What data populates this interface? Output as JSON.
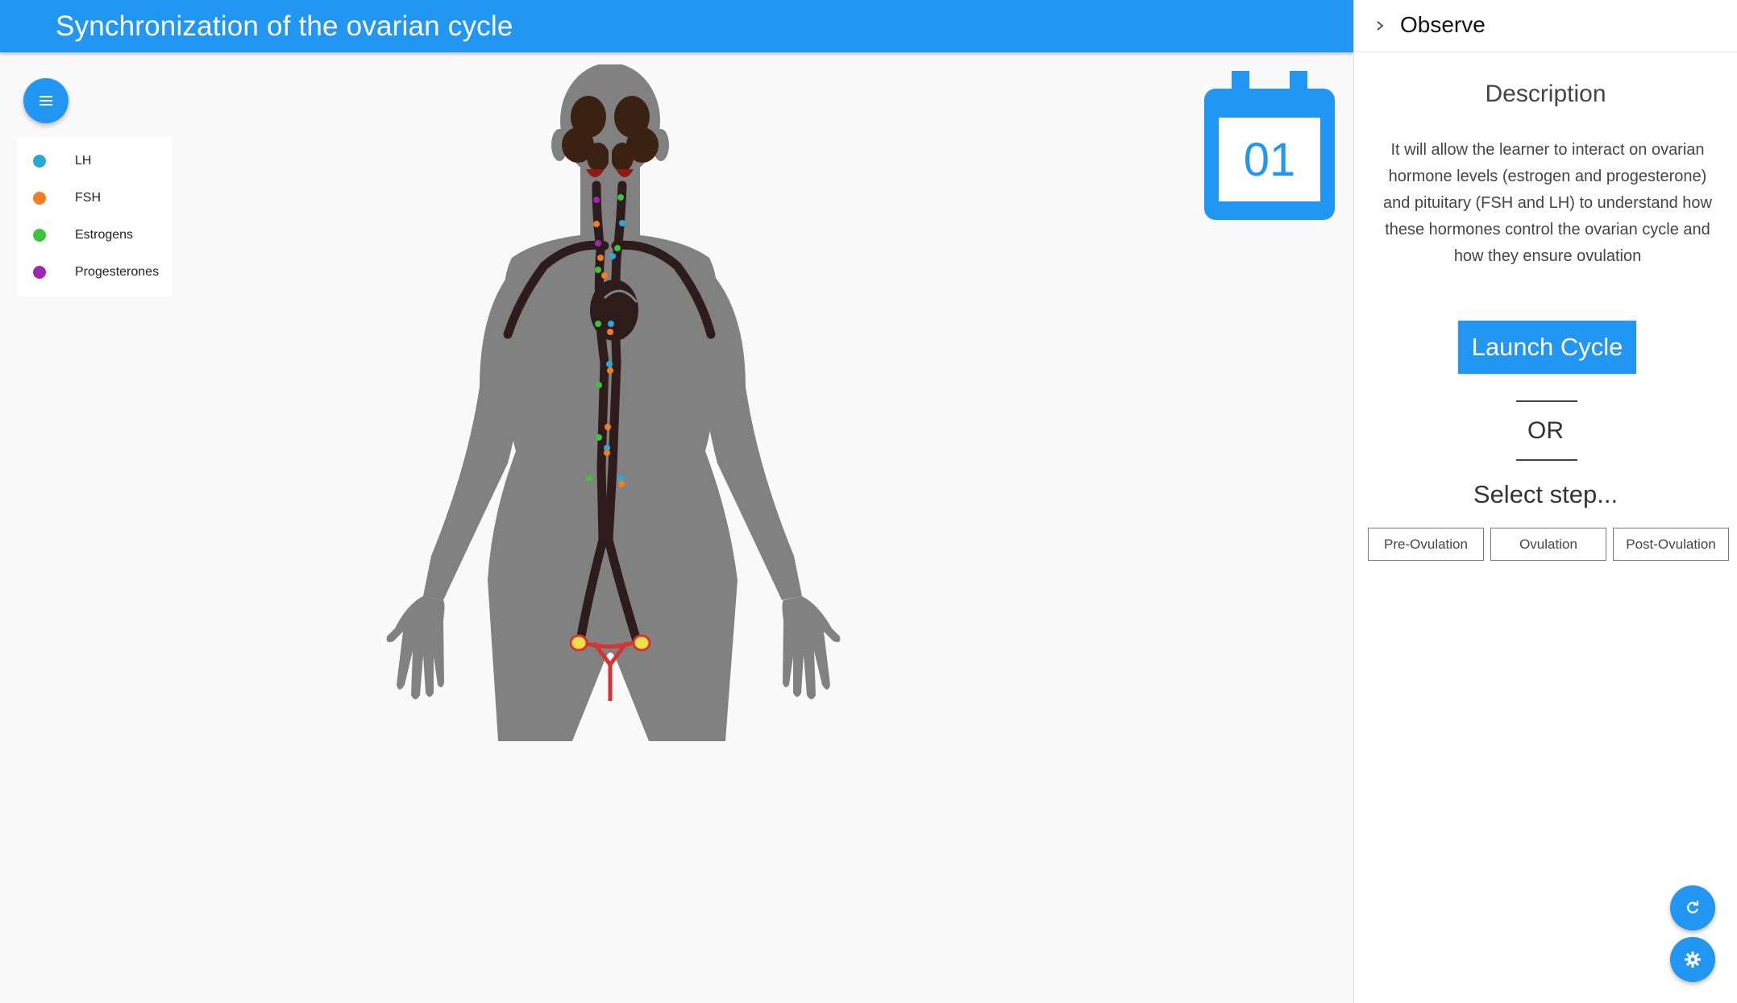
{
  "app": {
    "title": "Synchronization of the ovarian cycle",
    "accent_color": "#2196f3"
  },
  "menu_button": {
    "icon": "menu-icon"
  },
  "legend": {
    "items": [
      {
        "label": "LH",
        "color": "#29a9d6"
      },
      {
        "label": "FSH",
        "color": "#f57c22"
      },
      {
        "label": "Estrogens",
        "color": "#3cc43c"
      },
      {
        "label": "Progesterones",
        "color": "#9c27b0"
      }
    ]
  },
  "calendar": {
    "day": "01",
    "icon": "calendar-icon"
  },
  "panel": {
    "title": "Observe",
    "chevron_icon": "chevron-right-icon",
    "description_heading": "Description",
    "description_text": "It will allow the learner to interact on ovarian hormone levels (estrogen and progesterone) and pituitary (FSH and LH) to understand how these hormones control the ovarian cycle and how they ensure ovulation",
    "launch_label": "Launch Cycle",
    "or_label": "OR",
    "select_step_label": "Select step...",
    "steps": [
      "Pre-Ovulation",
      "Ovulation",
      "Post-Ovulation"
    ]
  },
  "fabs": {
    "refresh_icon": "refresh-icon",
    "settings_icon": "gear-icon"
  }
}
